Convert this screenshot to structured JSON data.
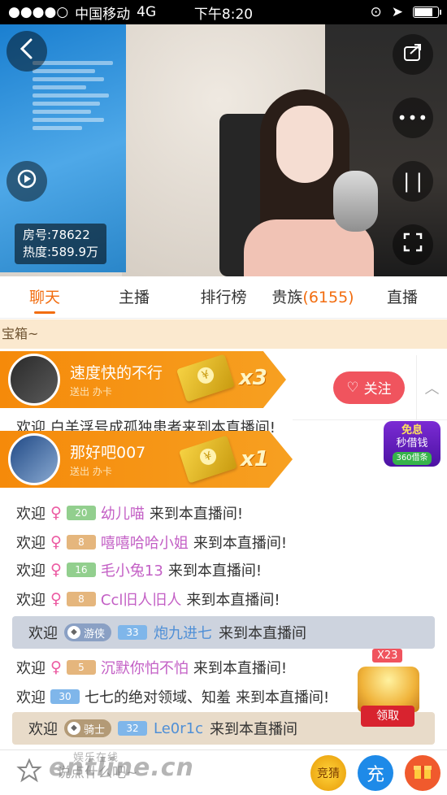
{
  "status_bar": {
    "signal": "●●●●○",
    "carrier": "中国移动",
    "network": "4G",
    "time": "下午8:20",
    "battery_level": 0.8
  },
  "video": {
    "room_number": "房号:78622",
    "popularity": "热度:589.9万"
  },
  "tabs": [
    {
      "label": "聊天",
      "active": true
    },
    {
      "label": "主播",
      "active": false
    },
    {
      "label": "排行榜",
      "active": false
    },
    {
      "label": "贵族",
      "count": "(6155)",
      "active": false
    },
    {
      "label": "直播",
      "active": false
    }
  ],
  "banner": {
    "text": "宝箱~"
  },
  "gifts": [
    {
      "name": "速度快的不行",
      "sub": "送出 办卡",
      "multiplier": "x3"
    },
    {
      "name": "那好吧007",
      "sub": "送出 办卡",
      "multiplier": "x1"
    }
  ],
  "follow": {
    "label": "关注"
  },
  "promo": {
    "line1": "免息",
    "line2": "秒借钱",
    "line3": "360借条"
  },
  "chat": {
    "partial_line": "欢迎   白羊浮号成孤独患者来到本直播间!",
    "messages": [
      {
        "welcome": "欢迎",
        "level": "20",
        "name": "幼儿喵",
        "suffix": "来到本直播间!"
      },
      {
        "welcome": "欢迎",
        "level": "8",
        "name": "嘻嘻哈哈小姐",
        "suffix": "来到本直播间!"
      },
      {
        "welcome": "欢迎",
        "level": "16",
        "name": "毛小兔13",
        "suffix": "来到本直播间!"
      },
      {
        "welcome": "欢迎",
        "level": "8",
        "name": "Ccl旧人旧人",
        "suffix": "来到本直播间!"
      },
      {
        "welcome": "欢迎",
        "level": "5",
        "name": "沉默你怕不怕",
        "suffix": "来到本直播间!"
      },
      {
        "welcome": "欢迎",
        "level": "30",
        "name": "七七的绝对领域、知羞",
        "suffix": "来到本直播间!"
      }
    ],
    "vip_rows": [
      {
        "welcome": "欢迎",
        "badge": "游侠",
        "level": "33",
        "name": "炮九进七",
        "suffix": "来到本直播间"
      },
      {
        "welcome": "欢迎",
        "badge": "骑士",
        "level": "32",
        "name": "Le0r1c",
        "suffix": "来到本直播间"
      }
    ]
  },
  "treasure": {
    "count": "X23",
    "claim_label": "领取"
  },
  "bottom_bar": {
    "input_placeholder": "说点什么吧~",
    "guess_label": "竞猜",
    "charge_label": "充",
    "watermark": "entline.cn",
    "watermark_small": "娱乐在线"
  },
  "icons": {
    "back": "chevron-left-icon",
    "share": "share-icon",
    "more": "more-icon",
    "replay": "replay-icon",
    "pause": "pause-icon",
    "fullscreen": "fullscreen-icon",
    "heart": "heart-icon",
    "gift": "gift-icon"
  },
  "colors": {
    "accent": "#f26d10",
    "gift_banner": "#f58a0a",
    "follow": "#f0545e",
    "female": "#ec5aa2"
  }
}
